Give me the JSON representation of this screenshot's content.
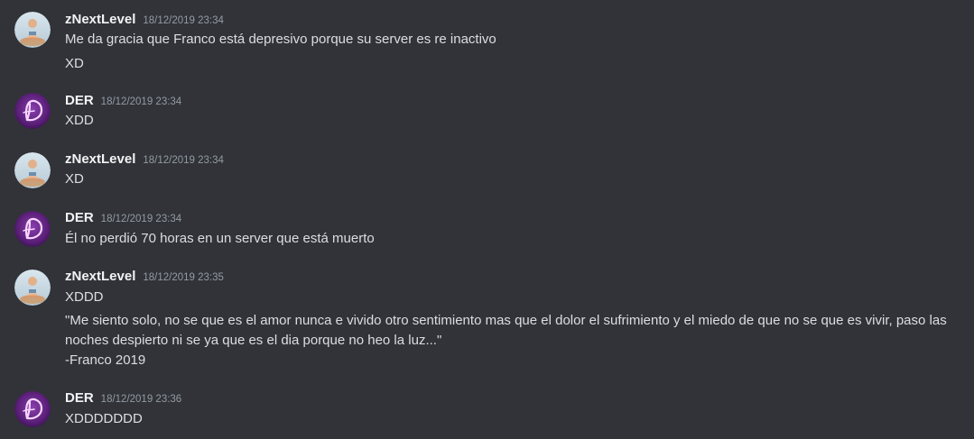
{
  "messages": [
    {
      "author": "zNextLevel",
      "timestamp": "18/12/2019 23:34",
      "avatar_icon": "meditating-person-avatar",
      "lines": [
        "Me da gracia que Franco está depresivo porque su server es re inactivo",
        "XD"
      ]
    },
    {
      "author": "DER",
      "timestamp": "18/12/2019 23:34",
      "avatar_icon": "purple-letter-d-avatar",
      "lines": [
        "XDD"
      ]
    },
    {
      "author": "zNextLevel",
      "timestamp": "18/12/2019 23:34",
      "avatar_icon": "meditating-person-avatar",
      "lines": [
        "XD"
      ]
    },
    {
      "author": "DER",
      "timestamp": "18/12/2019 23:34",
      "avatar_icon": "purple-letter-d-avatar",
      "lines": [
        "Él no perdió 70 horas en un server que está muerto"
      ]
    },
    {
      "author": "zNextLevel",
      "timestamp": "18/12/2019 23:35",
      "avatar_icon": "meditating-person-avatar",
      "lines": [
        "XDDD",
        "\"Me siento solo, no se que es el amor nunca e vivido otro sentimiento mas que el dolor el sufrimiento y el miedo de que no se que es vivir, paso las noches despierto ni se ya que es el dia porque no heo la luz...\"",
        "-Franco 2019"
      ]
    },
    {
      "author": "DER",
      "timestamp": "18/12/2019 23:36",
      "avatar_icon": "purple-letter-d-avatar",
      "lines": [
        "XDDDDDDD"
      ]
    }
  ],
  "colors": {
    "background": "#313338",
    "author": "#f2f3f5",
    "timestamp": "#949ba4",
    "text": "#dbdee1",
    "der_avatar": "#6a2a8a"
  }
}
